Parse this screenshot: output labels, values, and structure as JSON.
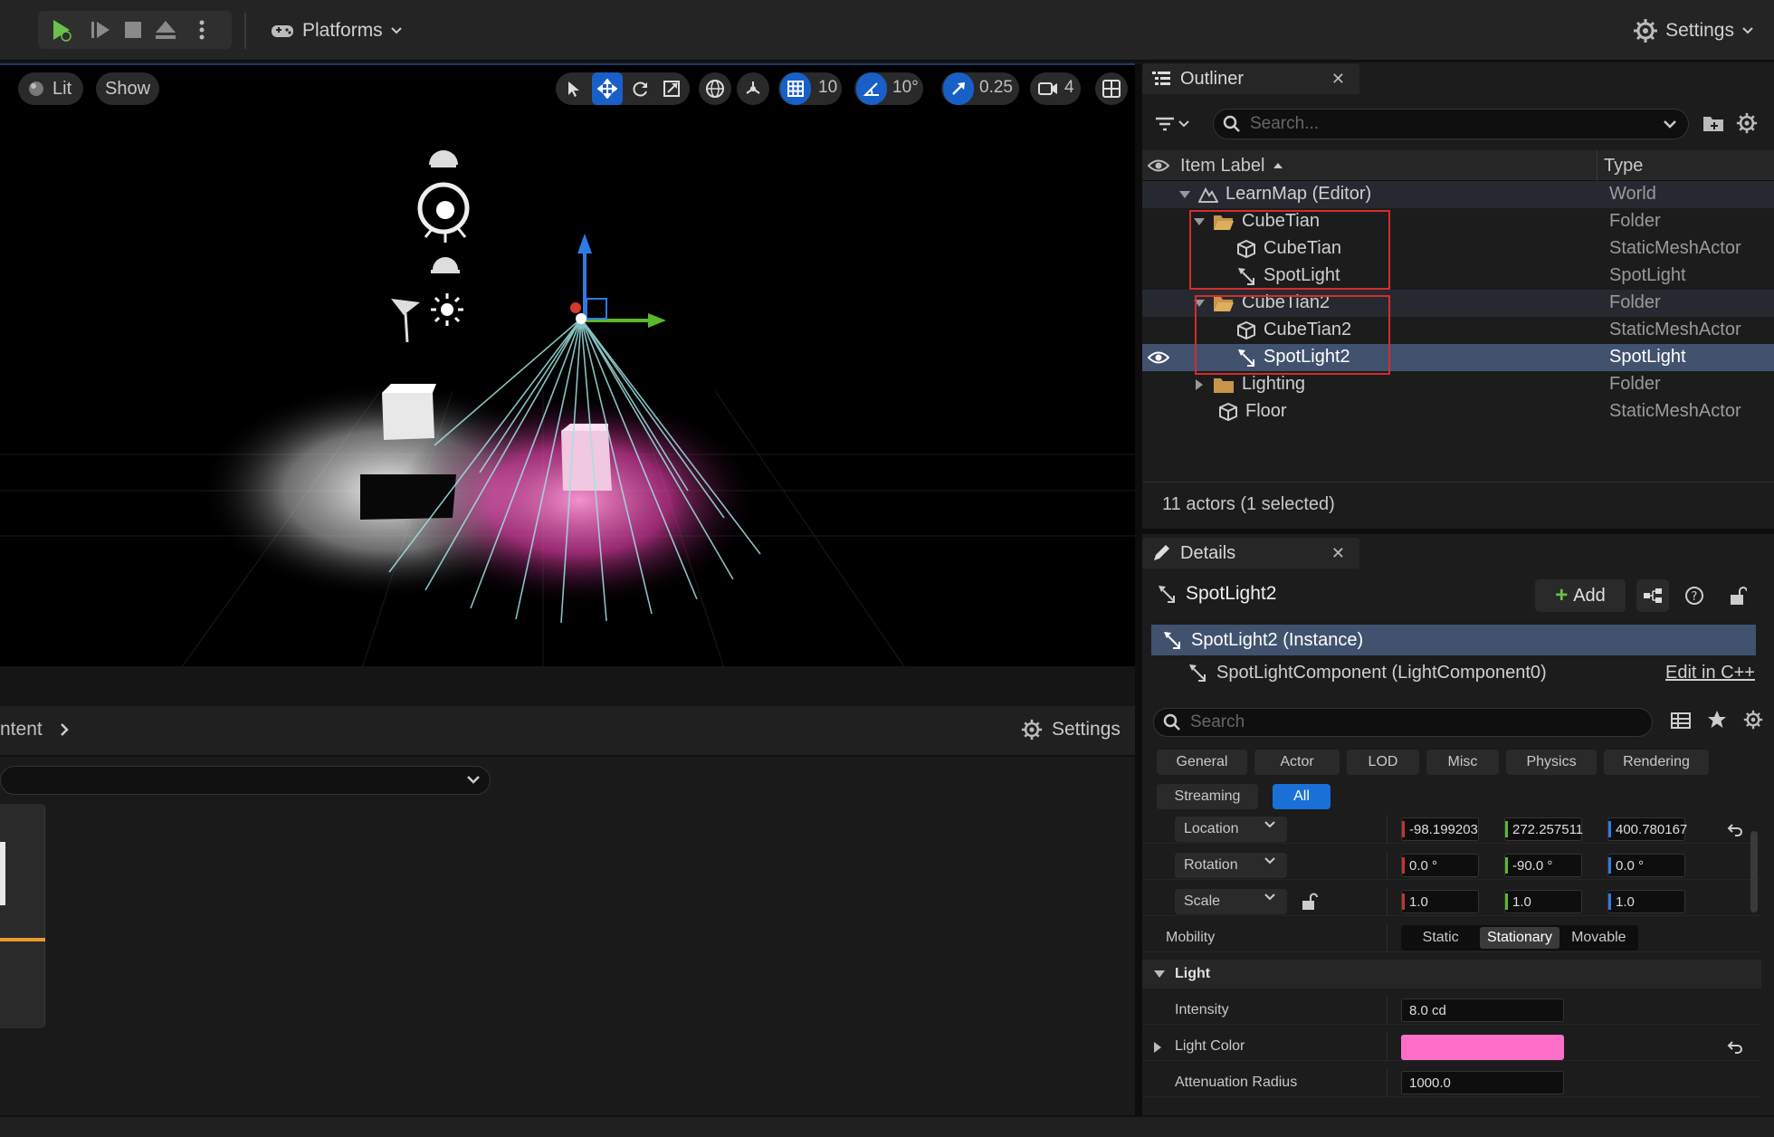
{
  "toolbar": {
    "platforms_label": "Platforms",
    "settings_label": "Settings"
  },
  "viewport": {
    "lit_label": "Lit",
    "show_label": "Show",
    "grid_snap": "10",
    "rotation_snap": "10°",
    "scale_snap": "0.25",
    "camera_speed": "4"
  },
  "content": {
    "path_label": "ntent",
    "settings_label": "Settings"
  },
  "outliner": {
    "tab_title": "Outliner",
    "search_placeholder": "Search...",
    "col_label": "Item Label",
    "col_type": "Type",
    "rows": [
      {
        "label": "LearnMap (Editor)",
        "type": "World"
      },
      {
        "label": "CubeTian",
        "type": "Folder"
      },
      {
        "label": "CubeTian",
        "type": "StaticMeshActor"
      },
      {
        "label": "SpotLight",
        "type": "SpotLight"
      },
      {
        "label": "CubeTian2",
        "type": "Folder"
      },
      {
        "label": "CubeTian2",
        "type": "StaticMeshActor"
      },
      {
        "label": "SpotLight2",
        "type": "SpotLight"
      },
      {
        "label": "Lighting",
        "type": "Folder"
      },
      {
        "label": "Floor",
        "type": "StaticMeshActor"
      }
    ],
    "actor_count": "11 actors (1 selected)"
  },
  "details": {
    "tab_title": "Details",
    "actor_name": "SpotLight2",
    "add_label": "Add",
    "instance_label": "SpotLight2 (Instance)",
    "component_label": "SpotLightComponent (LightComponent0)",
    "edit_cpp_label": "Edit in C++",
    "search_placeholder": "Search",
    "categories": [
      "General",
      "Actor",
      "LOD",
      "Misc",
      "Physics",
      "Rendering",
      "Streaming",
      "All"
    ],
    "transform": {
      "location_label": "Location",
      "location": [
        "-98.199203",
        "272.257511",
        "400.780167"
      ],
      "rotation_label": "Rotation",
      "rotation": [
        "0.0 °",
        "-90.0 °",
        "0.0 °"
      ],
      "scale_label": "Scale",
      "scale": [
        "1.0",
        "1.0",
        "1.0"
      ]
    },
    "mobility_label": "Mobility",
    "mobility_options": [
      "Static",
      "Stationary",
      "Movable"
    ],
    "mobility_selected": "Stationary",
    "light_section": "Light",
    "intensity_label": "Intensity",
    "intensity_value": "8.0 cd",
    "light_color_label": "Light Color",
    "light_color": "#ff6ec7",
    "attenuation_label": "Attenuation Radius",
    "attenuation_value": "1000.0"
  },
  "colors": {
    "accent_blue": "#1a70d6",
    "selection": "#40526e",
    "highlight_box": "#d82b2b",
    "play_green": "#6cc04a"
  }
}
